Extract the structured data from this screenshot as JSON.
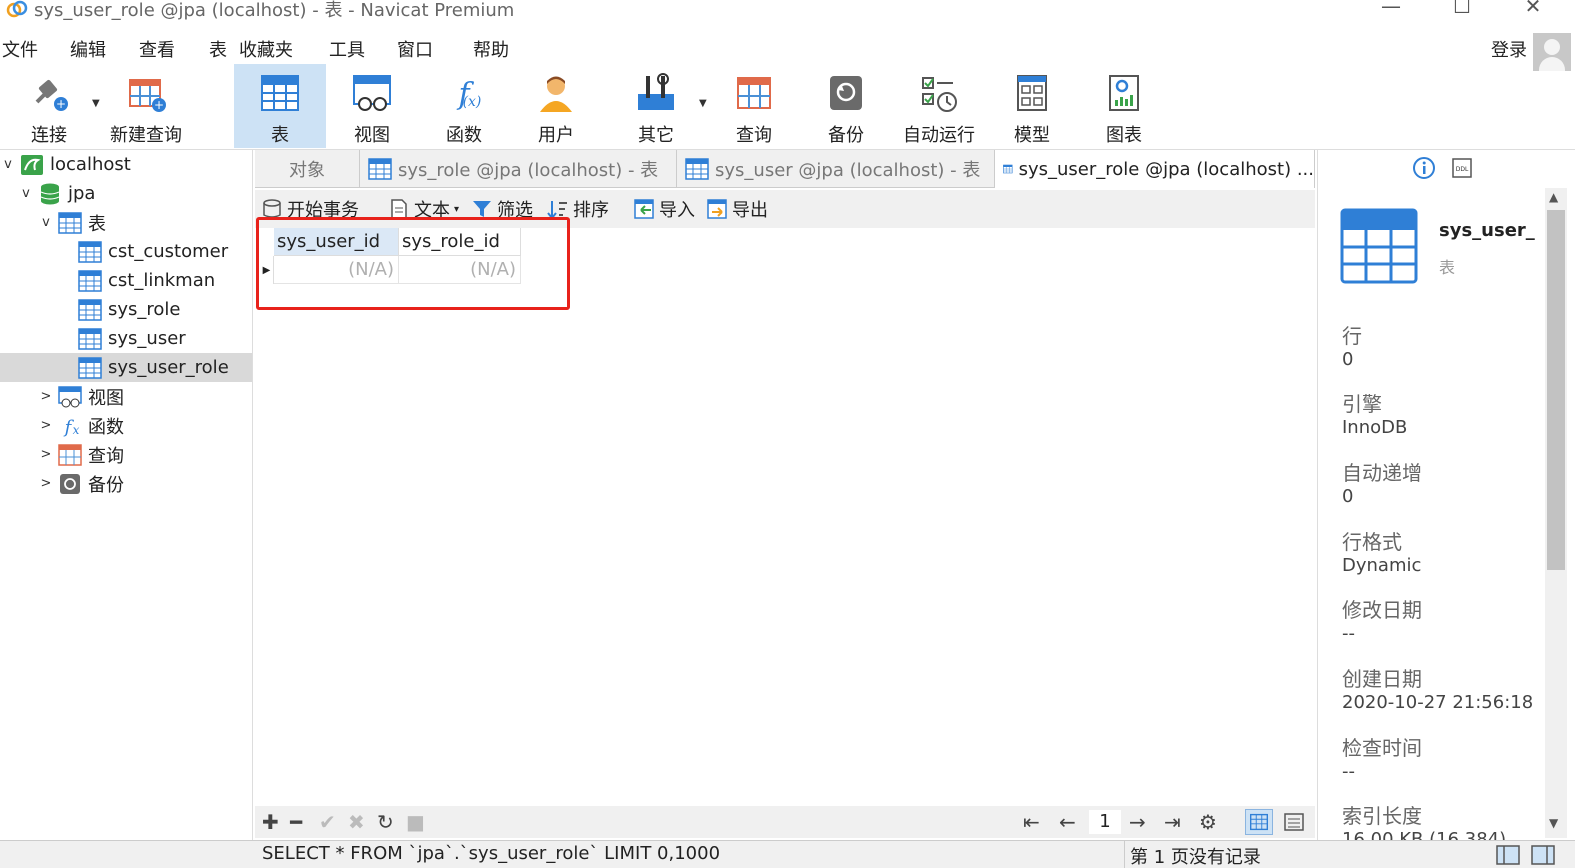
{
  "window": {
    "title": "sys_user_role @jpa (localhost) - 表 - Navicat Premium",
    "minimize": "—",
    "maximize": "☐",
    "close": "✕"
  },
  "menu": {
    "items": [
      "文件",
      "编辑",
      "查看",
      "表",
      "收藏夹",
      "工具",
      "窗口",
      "帮助"
    ],
    "login": "登录"
  },
  "toolbar": {
    "items": [
      "连接",
      "新建查询",
      "表",
      "视图",
      "函数",
      "用户",
      "其它",
      "查询",
      "备份",
      "自动运行",
      "模型",
      "图表"
    ],
    "active": "表"
  },
  "tree": {
    "connection": "localhost",
    "database": "jpa",
    "tables_group": "表",
    "tables": [
      "cst_customer",
      "cst_linkman",
      "sys_role",
      "sys_user",
      "sys_user_role"
    ],
    "selected": "sys_user_role",
    "groups": [
      "视图",
      "函数",
      "查询",
      "备份"
    ]
  },
  "tabs": {
    "objects": "对象",
    "items": [
      "sys_role @jpa (localhost) - 表",
      "sys_user @jpa (localhost) - 表",
      "sys_user_role @jpa (localhost) ..."
    ]
  },
  "subtoolbar": {
    "begin_transaction": "开始事务",
    "text": "文本",
    "filter": "筛选",
    "sort": "排序",
    "import": "导入",
    "export": "导出"
  },
  "grid": {
    "columns": [
      "sys_user_id",
      "sys_role_id"
    ],
    "rows": [
      [
        "(N/A)",
        "(N/A)"
      ]
    ]
  },
  "pager": {
    "page": "1"
  },
  "status": {
    "sql": "SELECT * FROM `jpa`.`sys_user_role` LIMIT 0,1000",
    "records": "第 1 页没有记录"
  },
  "info": {
    "name": "sys_user_",
    "type": "表",
    "props": [
      {
        "label": "行",
        "value": "0"
      },
      {
        "label": "引擎",
        "value": "InnoDB"
      },
      {
        "label": "自动递增",
        "value": "0"
      },
      {
        "label": "行格式",
        "value": "Dynamic"
      },
      {
        "label": "修改日期",
        "value": "--"
      },
      {
        "label": "创建日期",
        "value": "2020-10-27 21:56:18"
      },
      {
        "label": "检查时间",
        "value": "--"
      },
      {
        "label": "索引长度",
        "value": "16.00 KB (16,384)"
      }
    ]
  },
  "colors": {
    "accent": "#2f7fd6",
    "selection": "#cde2f5",
    "highlight_box": "#e8221b"
  }
}
